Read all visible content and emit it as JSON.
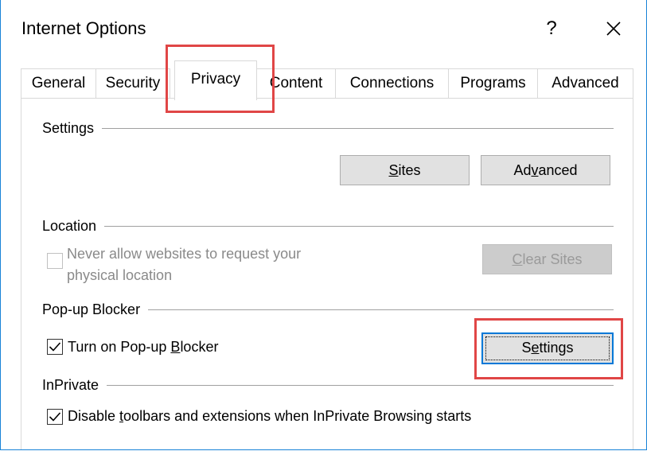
{
  "window": {
    "title": "Internet Options",
    "help_label": "?"
  },
  "tabs": [
    {
      "label": "General"
    },
    {
      "label": "Security"
    },
    {
      "label": "Privacy",
      "selected": true
    },
    {
      "label": "Content"
    },
    {
      "label": "Connections"
    },
    {
      "label": "Programs"
    },
    {
      "label": "Advanced"
    }
  ],
  "settings": {
    "label": "Settings",
    "sites_button": {
      "pre": "",
      "accel": "S",
      "post": "ites"
    },
    "advanced_button": {
      "pre": "Ad",
      "accel": "v",
      "post": "anced"
    }
  },
  "location": {
    "label": "Location",
    "checkbox_line1": "Never allow websites to request your",
    "checkbox_line2": "physical location",
    "checked": false,
    "enabled": false,
    "clear_sites_button": {
      "pre": "",
      "accel": "C",
      "post": "lear Sites"
    }
  },
  "popup": {
    "label": "Pop-up Blocker",
    "checkbox": {
      "pre": "Turn on Pop-up ",
      "accel": "B",
      "post": "locker"
    },
    "checked": true,
    "settings_button": {
      "pre": "S",
      "accel": "e",
      "post": "ttings"
    }
  },
  "inprivate": {
    "label": "InPrivate",
    "checkbox": {
      "pre": "Disable ",
      "accel": "t",
      "post": "oolbars and extensions when InPrivate Browsing starts"
    },
    "checked": true
  },
  "colors": {
    "highlight": "#e04646",
    "focus": "#0078d7",
    "window_border": "#1883d7"
  },
  "icons": {
    "close": "close-icon",
    "check": "check-icon"
  }
}
